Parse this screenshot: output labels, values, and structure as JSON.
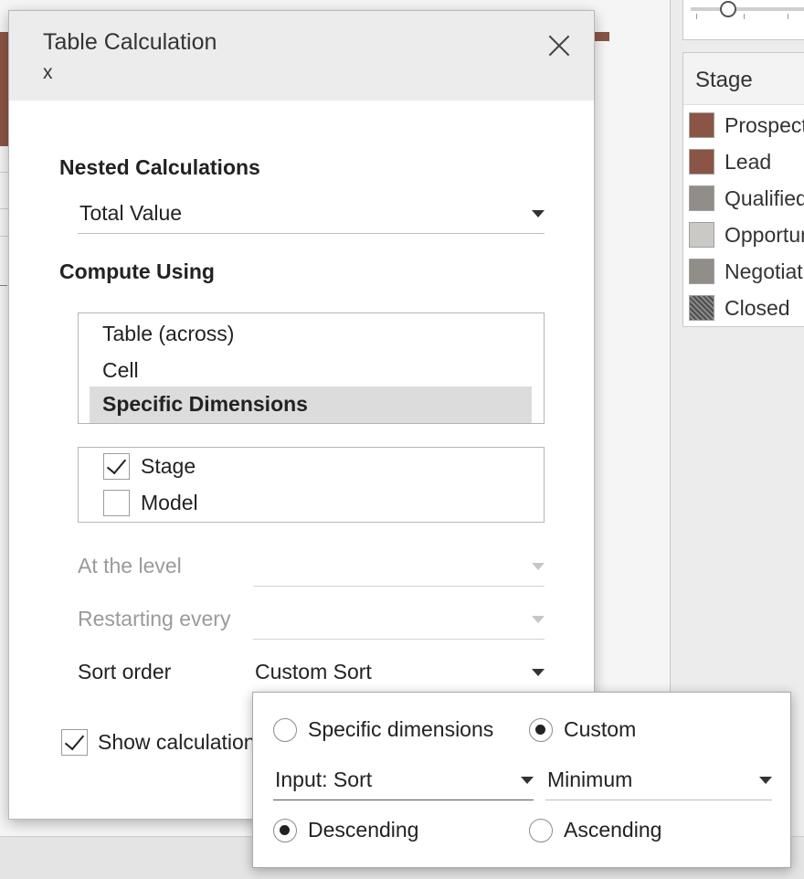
{
  "dialog": {
    "title": "Table Calculation",
    "subtitle": "x",
    "nested_heading": "Nested Calculations",
    "nested_value": "Total Value",
    "compute_heading": "Compute Using",
    "compute_options": [
      "Table (across)",
      "Cell",
      "Specific Dimensions"
    ],
    "selected_compute_option": "Specific Dimensions",
    "dimensions": [
      {
        "label": "Stage",
        "checked": true
      },
      {
        "label": "Model",
        "checked": false
      }
    ],
    "at_level_label": "At the level",
    "restarting_label": "Restarting every",
    "sort_order_label": "Sort order",
    "sort_order_value": "Custom Sort",
    "show_calc_label": "Show calculation assistance",
    "show_calc_checked": true
  },
  "sort_popup": {
    "mode_options": [
      "Specific dimensions",
      "Custom"
    ],
    "selected_mode": "Custom",
    "field_value": "Input: Sort",
    "aggregation_value": "Minimum",
    "direction_options": [
      "Descending",
      "Ascending"
    ],
    "selected_direction": "Descending"
  },
  "legend": {
    "title": "Stage",
    "items": [
      {
        "label": "Prospect",
        "color": "#8a5544"
      },
      {
        "label": "Lead",
        "color": "#8a5544"
      },
      {
        "label": "Qualified",
        "color": "#918e89"
      },
      {
        "label": "Opportunity",
        "color": "#cbc9c5"
      },
      {
        "label": "Negotiation",
        "color": "#918e89"
      },
      {
        "label": "Closed",
        "color": "hatched"
      }
    ]
  }
}
